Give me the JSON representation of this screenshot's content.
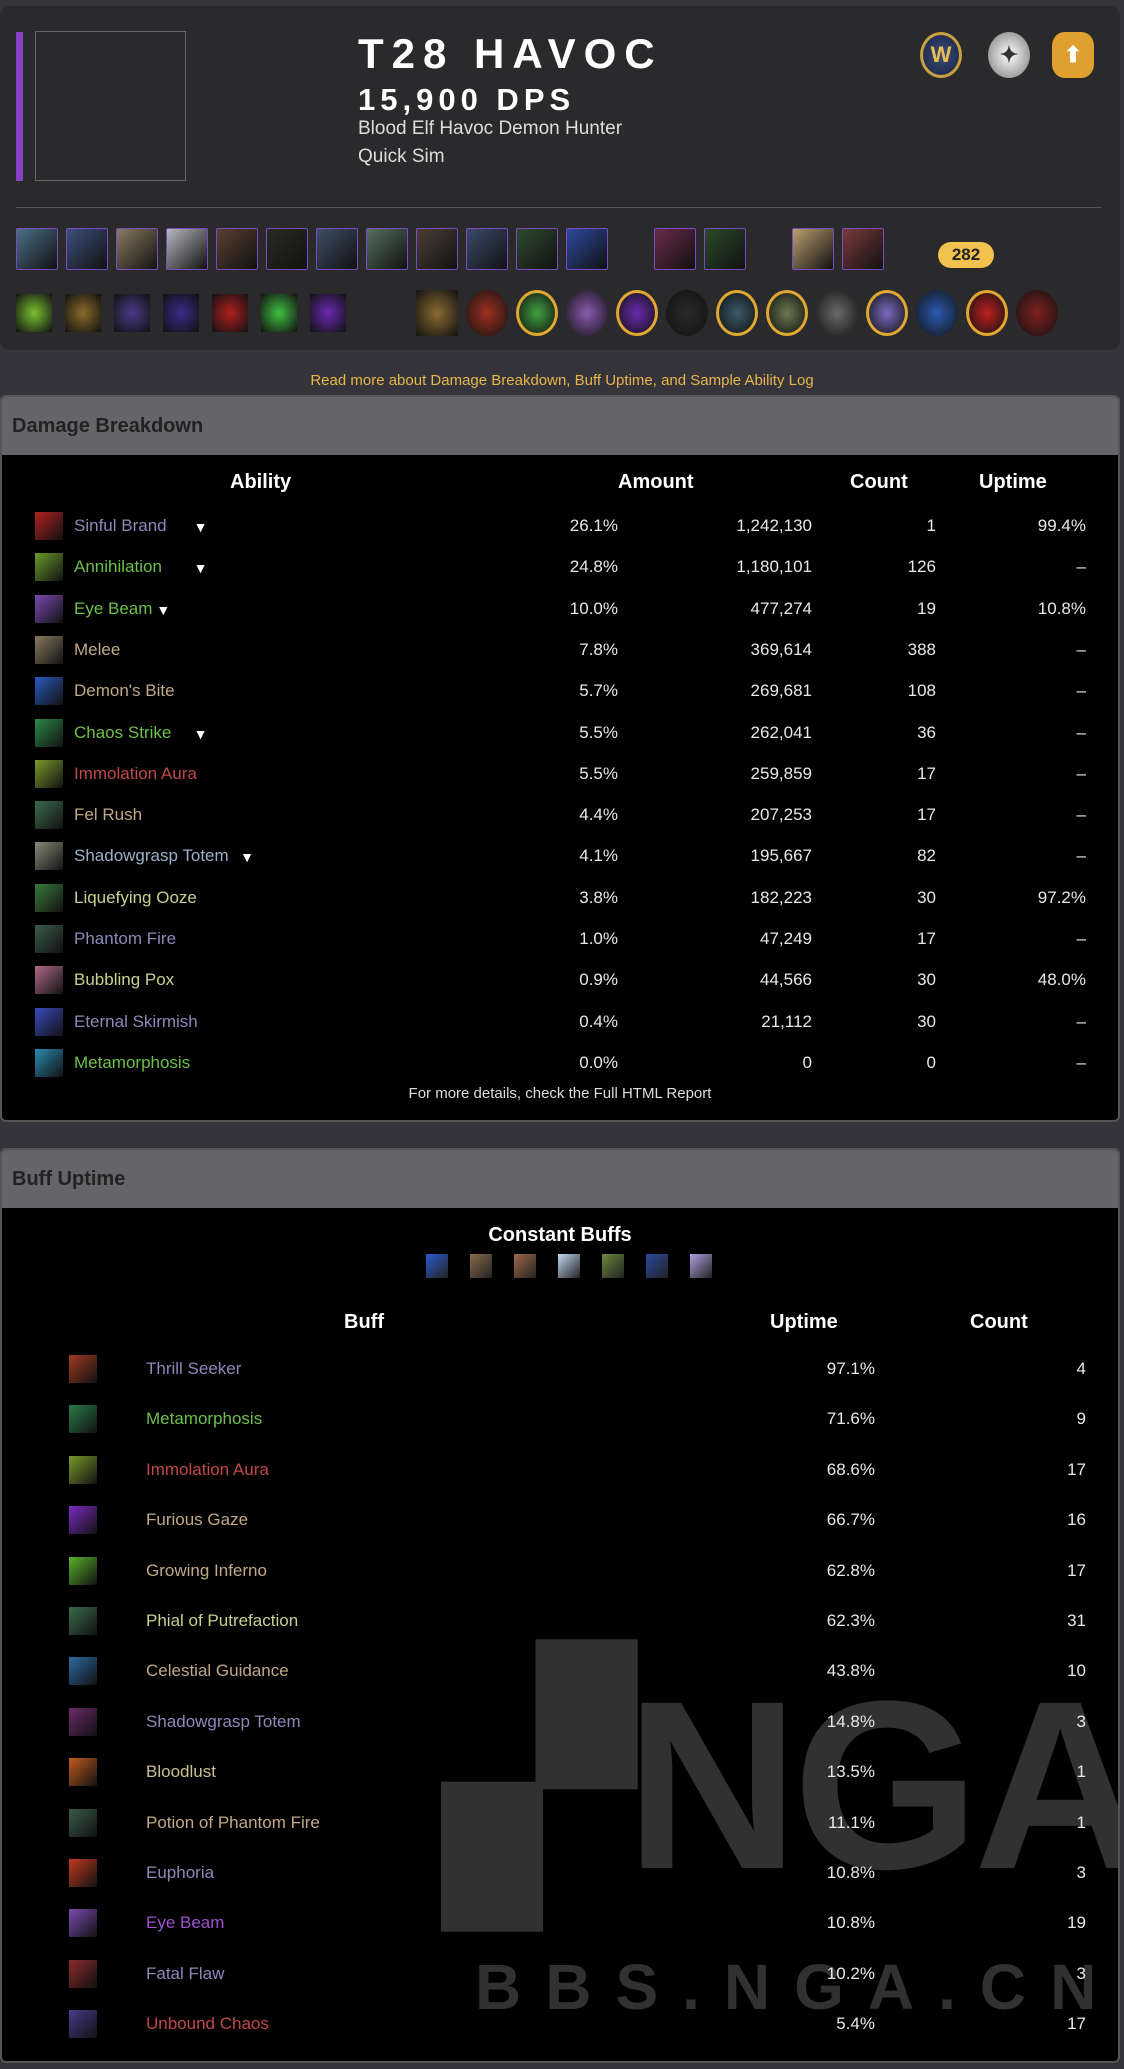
{
  "header": {
    "title": "T28 HAVOC",
    "dps": "15,900 DPS",
    "description": "Blood Elf Havoc Demon Hunter",
    "sim_type": "Quick Sim",
    "item_level": "282",
    "accent_color": "#8a3fc7",
    "logos": [
      "wow-logo-icon",
      "raidbots-icon",
      "simc-icon"
    ],
    "gear_colors": [
      "#4b6f86",
      "#3c4f7a",
      "#8a7a60",
      "#b8b8c0",
      "#5a4030",
      "#2b2a22",
      "#3e4e66",
      "#557060",
      "#4a3e36",
      "#3a4a6a",
      "#2f4a2f",
      "#2c4aa0",
      "#6a2a4a",
      "#2a4a2a",
      "#bba070",
      "#7a3a3a"
    ],
    "talent_colors": [
      "#7ac030",
      "#8a6a2a",
      "#4a3a8a",
      "#3a2a8a",
      "#b02020",
      "#40c040",
      "#6a2ab0"
    ],
    "gem_colors": [
      "#8a6a30",
      "#a03020",
      "#40a040",
      "#8a5ab0",
      "#6a2ab0",
      "#2a2a2a",
      "#3a5a6a",
      "#6a7a50",
      "#6a6a6a",
      "#7a6ac0",
      "#2a5ab0",
      "#c02020",
      "#802020"
    ]
  },
  "read_more": "Read more about Damage Breakdown, Buff Uptime, and Sample Ability Log",
  "damage": {
    "title": "Damage Breakdown",
    "columns": [
      "Ability",
      "Amount",
      "Count",
      "Uptime"
    ],
    "rows": [
      {
        "name": "Sinful Brand",
        "pct": "26.1%",
        "amount": "1,242,130",
        "count": "1",
        "uptime": "99.4%",
        "expand": "▼",
        "color": "#8c88b8",
        "icon": "#b02020"
      },
      {
        "name": "Annihilation",
        "pct": "24.8%",
        "amount": "1,180,101",
        "count": "126",
        "uptime": "–",
        "expand": "▼",
        "color": "#6cc04a",
        "icon": "#6a9a2a"
      },
      {
        "name": "Eye Beam",
        "pct": "10.0%",
        "amount": "477,274",
        "count": "19",
        "uptime": "10.8%",
        "expand": "▼",
        "color": "#6cc04a",
        "icon": "#7a4ab0"
      },
      {
        "name": "Melee",
        "pct": "7.8%",
        "amount": "369,614",
        "count": "388",
        "uptime": "–",
        "color": "#c0a888",
        "icon": "#8a7a60"
      },
      {
        "name": "Demon's Bite",
        "pct": "5.7%",
        "amount": "269,681",
        "count": "108",
        "uptime": "–",
        "color": "#c0a888",
        "icon": "#2a5ac0"
      },
      {
        "name": "Chaos Strike",
        "pct": "5.5%",
        "amount": "262,041",
        "count": "36",
        "uptime": "–",
        "expand": "▼",
        "color": "#6cc04a",
        "icon": "#2a8a4a"
      },
      {
        "name": "Immolation Aura",
        "pct": "5.5%",
        "amount": "259,859",
        "count": "17",
        "uptime": "–",
        "color": "#c04848",
        "icon": "#7a9a2a"
      },
      {
        "name": "Fel Rush",
        "pct": "4.4%",
        "amount": "207,253",
        "count": "17",
        "uptime": "–",
        "color": "#c0a888",
        "icon": "#3a6a4a"
      },
      {
        "name": "Shadowgrasp Totem",
        "pct": "4.1%",
        "amount": "195,667",
        "count": "82",
        "uptime": "–",
        "expand": "▼",
        "color": "#9ab0c8",
        "icon": "#8a8a7a"
      },
      {
        "name": "Liquefying Ooze",
        "pct": "3.8%",
        "amount": "182,223",
        "count": "30",
        "uptime": "97.2%",
        "color": "#c8d090",
        "icon": "#3a7a3a"
      },
      {
        "name": "Phantom Fire",
        "pct": "1.0%",
        "amount": "47,249",
        "count": "17",
        "uptime": "–",
        "color": "#8c88b8",
        "icon": "#3a5a4a"
      },
      {
        "name": "Bubbling Pox",
        "pct": "0.9%",
        "amount": "44,566",
        "count": "30",
        "uptime": "48.0%",
        "color": "#c8d090",
        "icon": "#b06a8a"
      },
      {
        "name": "Eternal Skirmish",
        "pct": "0.4%",
        "amount": "21,112",
        "count": "30",
        "uptime": "–",
        "color": "#8c88b8",
        "icon": "#3a4ac0"
      },
      {
        "name": "Metamorphosis",
        "pct": "0.0%",
        "amount": "0",
        "count": "0",
        "uptime": "–",
        "color": "#6cc04a",
        "icon": "#2a8ab0"
      }
    ],
    "footer": "For more details, check the Full HTML Report"
  },
  "buffs": {
    "title": "Buff Uptime",
    "constant_title": "Constant Buffs",
    "constant_icons": [
      "#2a5ad0",
      "#8a6a4a",
      "#a06a4a",
      "#c0d8f0",
      "#6a8a3a",
      "#2a4aa0",
      "#b0a0e0"
    ],
    "columns": [
      "Buff",
      "Uptime",
      "Count"
    ],
    "rows": [
      {
        "name": "Thrill Seeker",
        "uptime": "97.1%",
        "count": "4",
        "color": "#8c88b8",
        "icon": "#a03a20"
      },
      {
        "name": "Metamorphosis",
        "uptime": "71.6%",
        "count": "9",
        "color": "#6cc04a",
        "icon": "#2a7a4a"
      },
      {
        "name": "Immolation Aura",
        "uptime": "68.6%",
        "count": "17",
        "color": "#c04848",
        "icon": "#7a9a2a"
      },
      {
        "name": "Furious Gaze",
        "uptime": "66.7%",
        "count": "16",
        "color": "#c0a888",
        "icon": "#7a2ac0"
      },
      {
        "name": "Growing Inferno",
        "uptime": "62.8%",
        "count": "17",
        "color": "#c0a888",
        "icon": "#5ab02a"
      },
      {
        "name": "Phial of Putrefaction",
        "uptime": "62.3%",
        "count": "31",
        "color": "#c8d090",
        "icon": "#3a6a4a"
      },
      {
        "name": "Celestial Guidance",
        "uptime": "43.8%",
        "count": "10",
        "color": "#c0a888",
        "icon": "#2a6aa0"
      },
      {
        "name": "Shadowgrasp Totem",
        "uptime": "14.8%",
        "count": "3",
        "color": "#8c88b8",
        "icon": "#6a2a6a"
      },
      {
        "name": "Bloodlust",
        "uptime": "13.5%",
        "count": "1",
        "color": "#c8c090",
        "icon": "#c05a20"
      },
      {
        "name": "Potion of Phantom Fire",
        "uptime": "11.1%",
        "count": "1",
        "color": "#c0a888",
        "icon": "#3a5a4a"
      },
      {
        "name": "Euphoria",
        "uptime": "10.8%",
        "count": "3",
        "color": "#8c88b8",
        "icon": "#c03a20"
      },
      {
        "name": "Eye Beam",
        "uptime": "10.8%",
        "count": "19",
        "color": "#a050d0",
        "icon": "#7a4ab0"
      },
      {
        "name": "Fatal Flaw",
        "uptime": "10.2%",
        "count": "3",
        "color": "#8c88b8",
        "icon": "#8a2a2a"
      },
      {
        "name": "Unbound Chaos",
        "uptime": "5.4%",
        "count": "17",
        "color": "#c04848",
        "icon": "#4a3a8a"
      }
    ]
  },
  "watermark": {
    "logo": "NGA",
    "url": "BBS.NGA.CN"
  }
}
